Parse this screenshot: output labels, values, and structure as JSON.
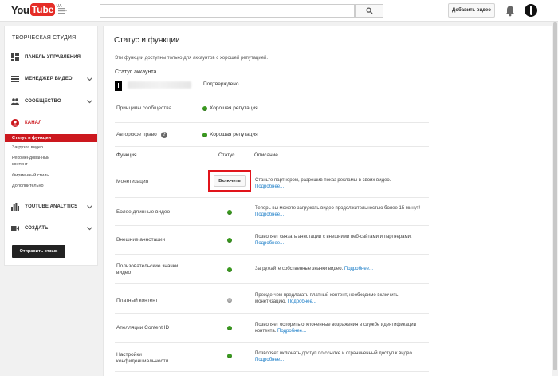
{
  "header": {
    "logo_you": "You",
    "logo_tube": "Tube",
    "logo_region": "UA",
    "search_placeholder": "",
    "upload_label": "Добавить видео",
    "icons": [
      "guide-menu-icon",
      "search-icon",
      "bell-icon",
      "avatar"
    ]
  },
  "sidebar": {
    "studio_title": "ТВОРЧЕСКАЯ СТУДИЯ",
    "items": [
      {
        "label": "ПАНЕЛЬ УПРАВЛЕНИЯ",
        "icon": "dashboard-icon"
      },
      {
        "label": "МЕНЕДЖЕР ВИДЕО",
        "icon": "video-manager-icon"
      },
      {
        "label": "СООБЩЕСТВО",
        "icon": "community-icon"
      },
      {
        "label": "КАНАЛ",
        "icon": "channel-icon"
      },
      {
        "label": "YOUTUBE ANALYTICS",
        "icon": "analytics-icon"
      },
      {
        "label": "СОЗДАТЬ",
        "icon": "create-icon"
      }
    ],
    "channel_subitems": [
      "Статус и функции",
      "Загрузка видео",
      "Рекомендованный",
      "контент",
      "Фирменный стиль",
      "Дополнительно"
    ],
    "feedback_label": "Отправить отзыв"
  },
  "main": {
    "title": "Статус и функции",
    "subtitle": "Эти функции доступны только для аккаунтов с хорошей репутацией.",
    "account_heading": "Статус аккаунта",
    "account_status": "Подтверждено",
    "community_label": "Принципы сообщества",
    "community_status": "Хорошая репутация",
    "copyright_label": "Авторское право",
    "copyright_help": "?",
    "copyright_status": "Хорошая репутация",
    "col_function": "Функция",
    "col_status": "Статус",
    "col_description": "Описание",
    "more": "Подробнее...",
    "features": [
      {
        "label": "Монетизация",
        "status": "button",
        "button_label": "Включить",
        "desc": "Станьте партнером, разрешив показ рекламы в своих видео."
      },
      {
        "label": "Более длинные видео",
        "status": "enabled",
        "desc": "Теперь вы можете загружать видео продолжительностью более 15 минут!"
      },
      {
        "label": "Внешние аннотации",
        "status": "enabled",
        "desc": "Позволяет связать аннотации с внешними веб-сайтами и партнерами."
      },
      {
        "label_line1": "Пользовательские значки",
        "label_line2": "видео",
        "status": "enabled",
        "desc": "Загружайте собственные значки видео."
      },
      {
        "label": "Платный контент",
        "status": "disabled",
        "desc": "Прежде чем предлагать платный контент, необходимо включить монетизацию."
      },
      {
        "label": "Апелляции Content ID",
        "status": "enabled",
        "desc": "Позволяет оспорить отклоненные возражения в службе идентификации контента."
      },
      {
        "label_line1": "Настройки",
        "label_line2": "конфиденциальности",
        "status": "enabled",
        "desc": "Позволяет включать доступ по ссылке и ограниченный доступ к видео."
      }
    ]
  },
  "colors": {
    "brand_red": "#e52d27",
    "active_red": "#cc181e",
    "status_green": "#3a9a1f",
    "status_grey": "#b5b5b5",
    "link_blue": "#167ac6"
  }
}
